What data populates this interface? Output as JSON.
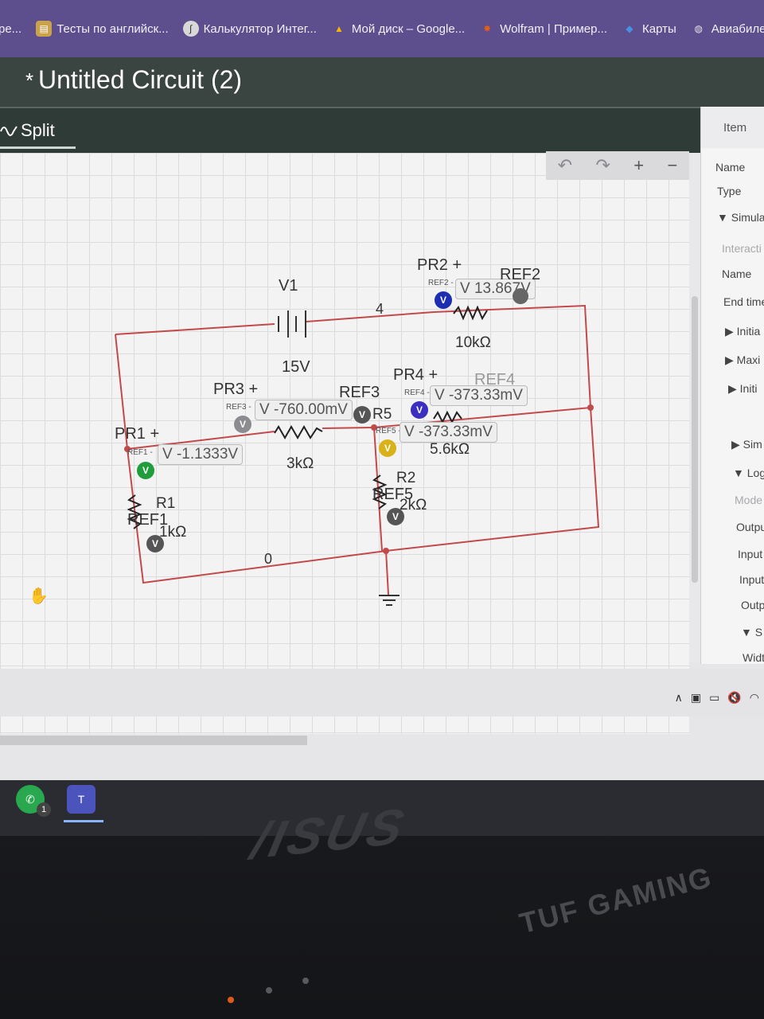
{
  "bookmarks": [
    {
      "label": "ре...",
      "icon": "",
      "color": "#5d4f8e"
    },
    {
      "label": "Тесты по английск...",
      "icon": "doc-icon",
      "color": "#c9a24a"
    },
    {
      "label": "Калькулятор Интег...",
      "icon": "calculator-icon",
      "color": "#d8d8d8"
    },
    {
      "label": "Мой диск – Google...",
      "icon": "drive-icon",
      "color": "#f4b400"
    },
    {
      "label": "Wolfram | Пример...",
      "icon": "wolfram-icon",
      "color": "#e65c18"
    },
    {
      "label": "Карты",
      "icon": "maps-icon",
      "color": "#4a90e2"
    },
    {
      "label": "Авиабилеты",
      "icon": "globe-icon",
      "color": "#cfcfd2"
    }
  ],
  "window": {
    "modified_mark": "*",
    "title": "Untitled Circuit (2)"
  },
  "toolbar": {
    "split_label": "Split"
  },
  "canvas_controls": [
    "↶",
    "↷",
    "+",
    "−"
  ],
  "circuit": {
    "source": {
      "name": "V1",
      "value": "15V"
    },
    "node_labels": {
      "top": "4",
      "bottom": "0"
    },
    "resistors": [
      {
        "name": "R1",
        "value": "1kΩ"
      },
      {
        "name": "R2",
        "value": "2kΩ"
      },
      {
        "name": "",
        "value": "3kΩ"
      },
      {
        "name": "",
        "value": "10kΩ"
      },
      {
        "name": "R5",
        "value": "5.6kΩ"
      }
    ],
    "probes": [
      {
        "name": "PR1 +",
        "ref": "REF1",
        "ref_small": "REF1 -",
        "reading": "V -1.1333V",
        "color": "#1f9d3a"
      },
      {
        "name": "PR2 +",
        "ref": "REF2",
        "ref_small": "REF2 -",
        "reading": "V 13.867V",
        "color": "#1b2fb0"
      },
      {
        "name": "PR3 +",
        "ref": "REF3",
        "ref_small": "REF3 -",
        "reading": "V -760.00mV",
        "color": "#8c8c90"
      },
      {
        "name": "PR4 +",
        "ref": "REF4",
        "ref_small": "REF4 -",
        "reading": "V -373.33mV",
        "color": "#3a2fc0"
      },
      {
        "name": "",
        "ref": "REF5",
        "ref_small": "REF5 -",
        "reading": "V -373.33mV",
        "color": "#d9b21a"
      }
    ],
    "probe_letter": "V"
  },
  "panel": {
    "header": "Item",
    "rows": [
      {
        "label": "Name",
        "muted": false
      },
      {
        "label": "Type",
        "muted": false
      },
      {
        "label": "▼ Simula",
        "muted": false
      },
      {
        "label": "Interacti",
        "muted": true
      },
      {
        "label": "Name",
        "muted": false
      },
      {
        "label": "End time",
        "muted": false
      },
      {
        "label": "▶ Initia",
        "muted": false
      },
      {
        "label": "▶ Maxi",
        "muted": false
      },
      {
        "label": "▶ Initi",
        "muted": false
      },
      {
        "label": "▶ Sim",
        "muted": false
      },
      {
        "label": "▼ Log",
        "muted": false
      },
      {
        "label": "Mode",
        "muted": true
      },
      {
        "label": "Outpu",
        "muted": false
      },
      {
        "label": "Input",
        "muted": false
      },
      {
        "label": "Input",
        "muted": false
      },
      {
        "label": "Outp",
        "muted": false
      },
      {
        "label": "▼ S",
        "muted": false
      },
      {
        "label": "Widt",
        "muted": false
      }
    ]
  },
  "dock": {
    "whatsapp_badge": "1"
  },
  "brands": {
    "laptop": "/ISUS",
    "series": "TUF GAMING"
  }
}
